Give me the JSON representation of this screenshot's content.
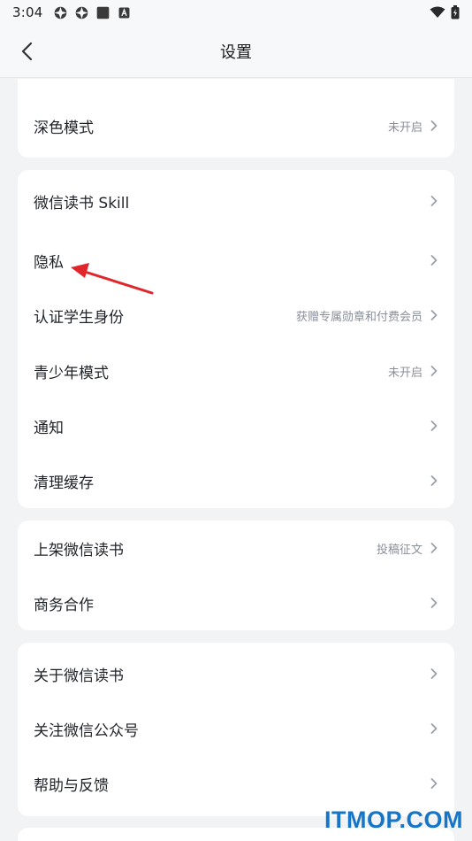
{
  "status_bar": {
    "time": "3:04",
    "icons": [
      "app-icon-1",
      "app-icon-2",
      "square-icon",
      "a-badge-icon",
      "wifi-icon",
      "battery-icon"
    ]
  },
  "nav": {
    "title": "设置",
    "back_icon": "back-chevron-icon"
  },
  "groups": [
    {
      "items": [
        {
          "label": "深色模式",
          "hint": "未开启"
        }
      ]
    },
    {
      "items": [
        {
          "label": "微信读书 Skill",
          "hint": ""
        },
        {
          "label": "隐私",
          "hint": ""
        },
        {
          "label": "认证学生身份",
          "hint": "获赠专属勋章和付费会员"
        },
        {
          "label": "青少年模式",
          "hint": "未开启"
        },
        {
          "label": "通知",
          "hint": ""
        },
        {
          "label": "清理缓存",
          "hint": ""
        }
      ]
    },
    {
      "items": [
        {
          "label": "上架微信读书",
          "hint": "投稿征文"
        },
        {
          "label": "商务合作",
          "hint": ""
        }
      ]
    },
    {
      "items": [
        {
          "label": "关于微信读书",
          "hint": ""
        },
        {
          "label": "关注微信公众号",
          "hint": ""
        },
        {
          "label": "帮助与反馈",
          "hint": ""
        }
      ]
    }
  ],
  "annotation": {
    "color": "#e0262b"
  },
  "watermark": "ITMOP.COM",
  "colors": {
    "background": "#f2f3f5",
    "card": "#ffffff",
    "hint": "#8a8f99"
  }
}
